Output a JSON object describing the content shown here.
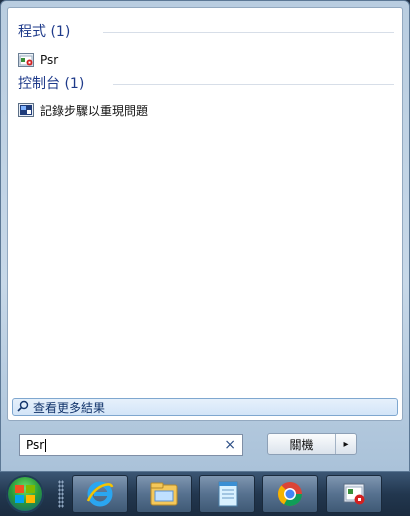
{
  "results": {
    "groups": [
      {
        "header": "程式 (1)",
        "items": [
          {
            "label": "Psr",
            "icon": "psr-icon"
          }
        ]
      },
      {
        "header": "控制台 (1)",
        "items": [
          {
            "label": "記錄步驟以重現問題",
            "icon": "record-steps-icon"
          }
        ]
      }
    ],
    "see_more": "查看更多結果"
  },
  "search": {
    "value": "Psr",
    "clear": "×"
  },
  "shutdown": {
    "label": "關機",
    "arrow": "▸"
  },
  "taskbar": {
    "items": [
      "start-orb",
      "ie-icon",
      "explorer-icon",
      "notepad-icon",
      "chrome-icon",
      "psr-app-icon"
    ]
  },
  "colors": {
    "group_header": "#1e3a8a",
    "see_more_bg": "#d3e5f8",
    "taskbar": "#22374f"
  }
}
